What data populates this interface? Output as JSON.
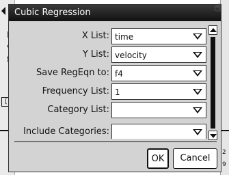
{
  "dialog": {
    "title": "Cubic Regression",
    "fields": [
      {
        "label": "X List:",
        "value": "time"
      },
      {
        "label": "Y List:",
        "value": "velocity"
      },
      {
        "label": "Save RegEqn to:",
        "value": "f4"
      },
      {
        "label": "Frequency List:",
        "value": "1"
      },
      {
        "label": "Category List:",
        "value": ""
      },
      {
        "label": "Include Categories:",
        "value": ""
      }
    ],
    "ok_label": "OK",
    "cancel_label": "Cancel"
  },
  "background": {
    "left_fragments": [
      "F",
      "v",
      "fo",
      "[",
      "|"
    ],
    "right_fragments": [
      "2",
      "9"
    ]
  },
  "icons": {
    "dropdown": "chevron-down-icon",
    "scroll_up": "scroll-up-arrow-icon",
    "scroll_down": "scroll-down-arrow-icon",
    "pointer": "hand-pointer-icon"
  }
}
